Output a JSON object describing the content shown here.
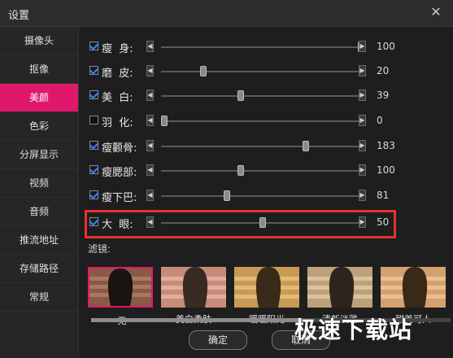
{
  "window": {
    "title": "设置"
  },
  "sidebar": {
    "items": [
      {
        "label": "摄像头",
        "active": false
      },
      {
        "label": "抠像",
        "active": false
      },
      {
        "label": "美颜",
        "active": true
      },
      {
        "label": "色彩",
        "active": false
      },
      {
        "label": "分屏显示",
        "active": false
      },
      {
        "label": "视频",
        "active": false
      },
      {
        "label": "音频",
        "active": false
      },
      {
        "label": "推流地址",
        "active": false
      },
      {
        "label": "存储路径",
        "active": false
      },
      {
        "label": "常规",
        "active": false
      }
    ]
  },
  "beauty": {
    "sliders": [
      {
        "label": "瘦  身:",
        "value": "100",
        "checked": true,
        "level": 1.0
      },
      {
        "label": "磨  皮:",
        "value": "20",
        "checked": true,
        "level": 0.2
      },
      {
        "label": "美  白:",
        "value": "39",
        "checked": true,
        "level": 0.39
      },
      {
        "label": "羽  化:",
        "value": "0",
        "checked": false,
        "level": 0.0
      },
      {
        "label": "瘦颧骨:",
        "value": "183",
        "checked": true,
        "level": 0.72
      },
      {
        "label": "瘦腮部:",
        "value": "100",
        "checked": true,
        "level": 0.39
      },
      {
        "label": "瘦下巴:",
        "value": "81",
        "checked": true,
        "level": 0.32
      },
      {
        "label": "大  眼:",
        "value": "50",
        "checked": true,
        "level": 0.5
      }
    ]
  },
  "filters": {
    "label": "滤镜:",
    "items": [
      {
        "name": "无",
        "selected": true
      },
      {
        "name": "美白柔肤",
        "selected": false
      },
      {
        "name": "暖暖阳光",
        "selected": false
      },
      {
        "name": "清新淡雅",
        "selected": false
      },
      {
        "name": "甜美可人",
        "selected": false
      }
    ]
  },
  "buttons": {
    "ok": "确定",
    "cancel": "取消"
  },
  "watermark": "极速下载站",
  "colors": {
    "accent": "#e0186b",
    "highlight": "#e53232",
    "check": "#2b8bff"
  }
}
